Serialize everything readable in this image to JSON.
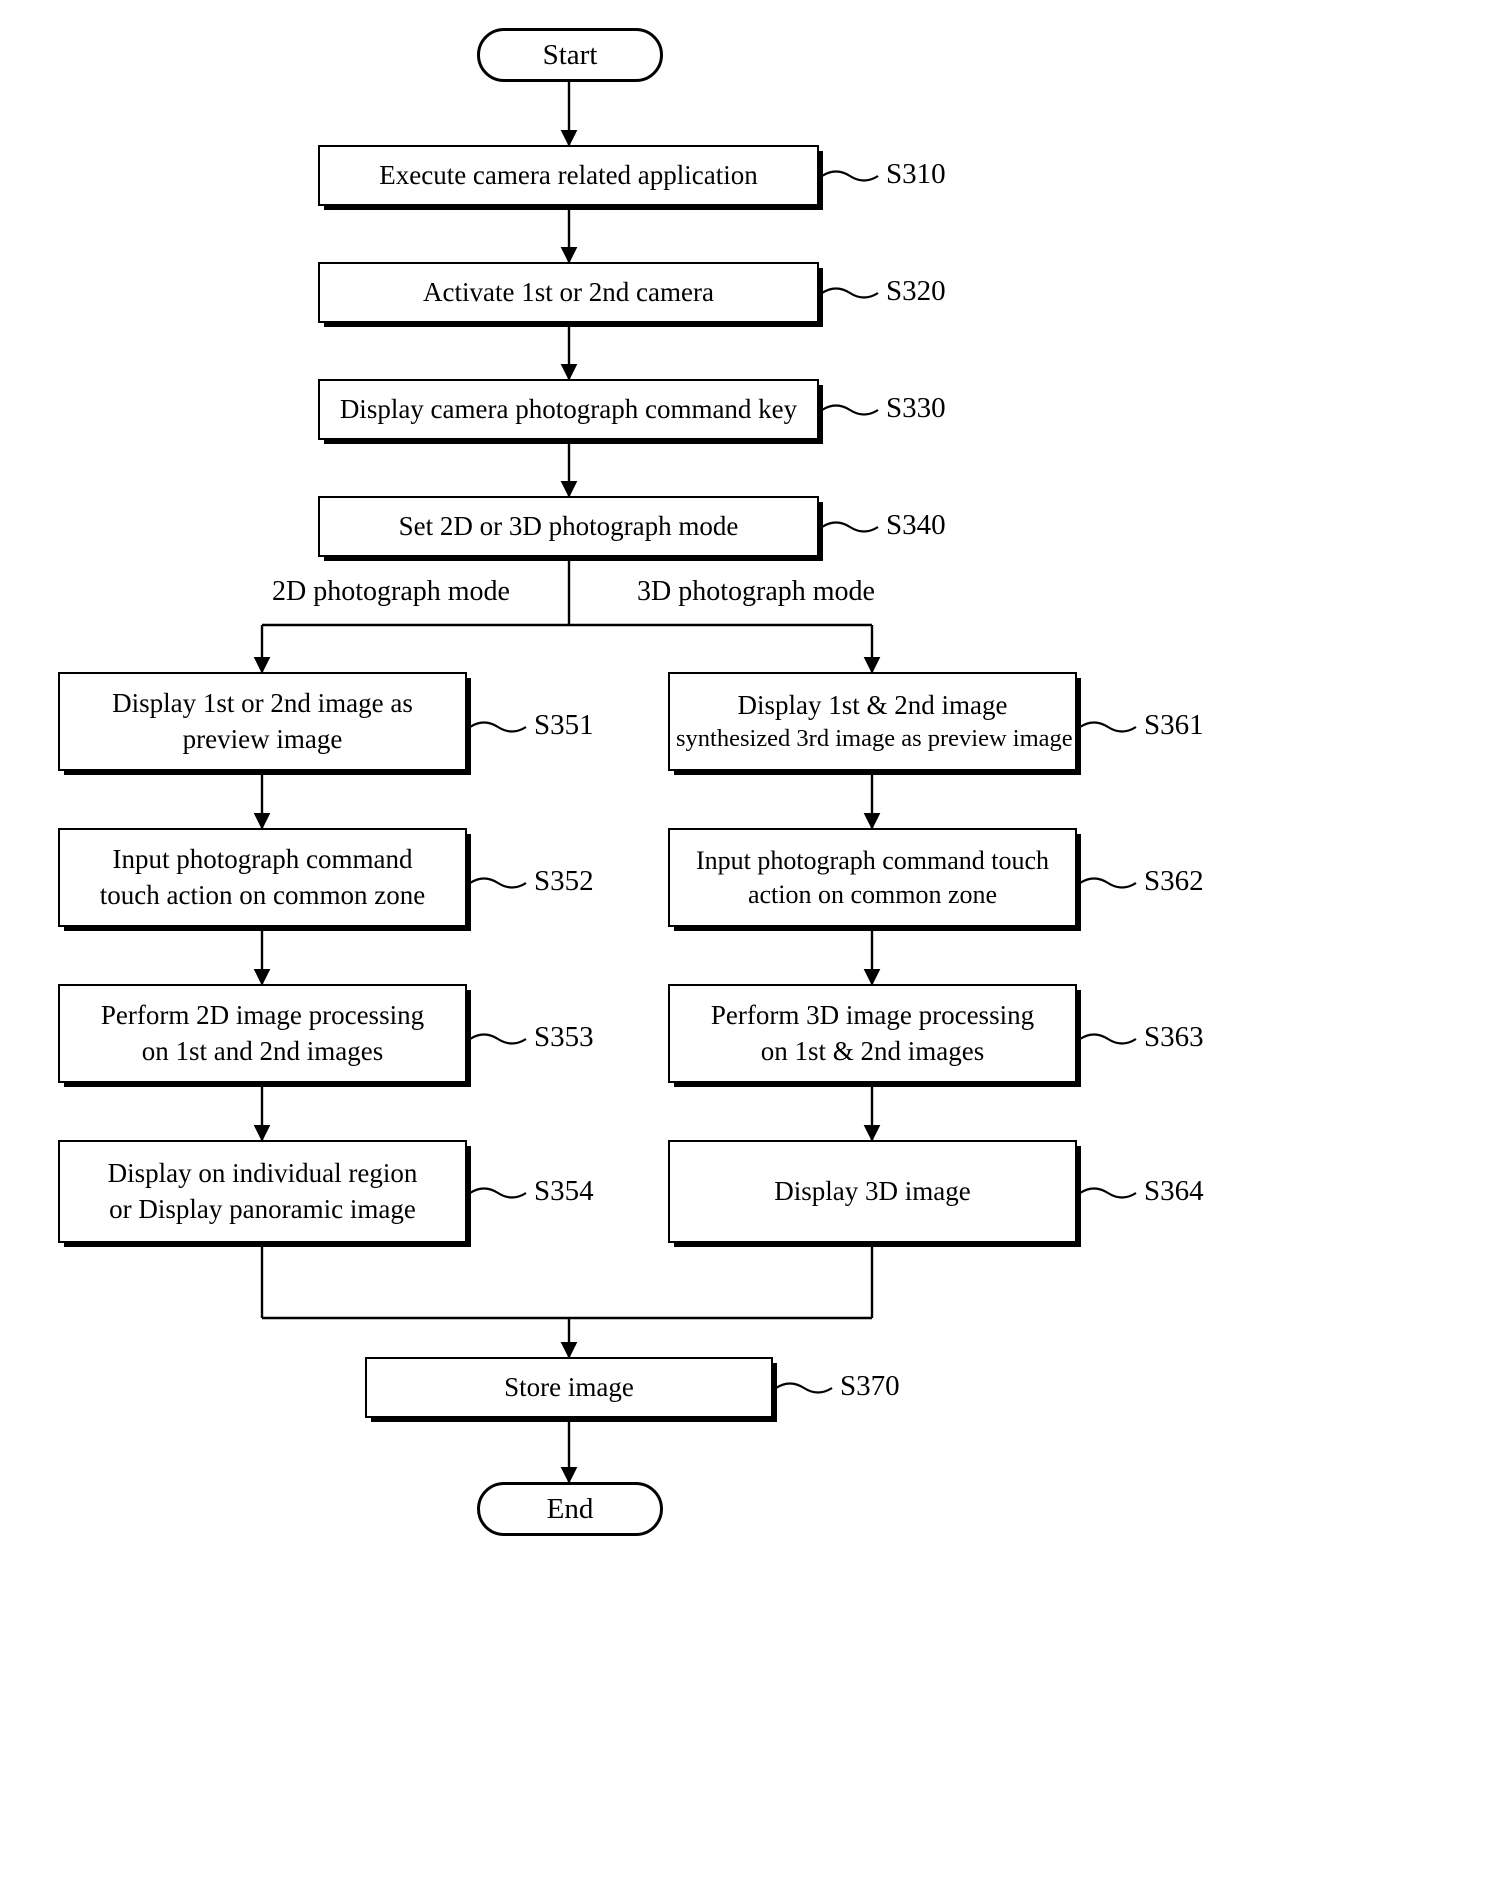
{
  "diagram": {
    "type": "flowchart",
    "title_text": "",
    "start": {
      "label": "Start"
    },
    "end": {
      "label": "End"
    },
    "main_steps": [
      {
        "id": "S310",
        "text_lines": [
          "Execute camera related application"
        ],
        "ref": "S310"
      },
      {
        "id": "S320",
        "text_lines": [
          "Activate 1st or 2nd camera"
        ],
        "ref": "S320"
      },
      {
        "id": "S330",
        "text_lines": [
          "Display camera photograph command key"
        ],
        "ref": "S330"
      },
      {
        "id": "S340",
        "text_lines": [
          "Set 2D or 3D photograph mode"
        ],
        "ref": "S340"
      }
    ],
    "branch_labels": {
      "left": "2D photograph mode",
      "right": "3D photograph mode"
    },
    "left_branch": [
      {
        "id": "S351",
        "text_lines": [
          "Display 1st or 2nd image as",
          "preview image"
        ],
        "ref": "S351"
      },
      {
        "id": "S352",
        "text_lines": [
          "Input photograph command",
          "touch action on common zone"
        ],
        "ref": "S352"
      },
      {
        "id": "S353",
        "text_lines": [
          "Perform 2D image processing",
          "on 1st and 2nd images"
        ],
        "ref": "S353"
      },
      {
        "id": "S354",
        "text_lines": [
          "Display on individual region",
          "or Display panoramic image"
        ],
        "ref": "S354"
      }
    ],
    "right_branch": [
      {
        "id": "S361",
        "text_lines": [
          "Display 1st & 2nd image",
          "synthesized 3rd image as preview image"
        ],
        "ref": "S361"
      },
      {
        "id": "S362",
        "text_lines": [
          "Input photograph command touch",
          "action on common zone"
        ],
        "ref": "S362"
      },
      {
        "id": "S363",
        "text_lines": [
          "Perform 3D image processing",
          "on 1st & 2nd images"
        ],
        "ref": "S363"
      },
      {
        "id": "S364",
        "text_lines": [
          "Display 3D image"
        ],
        "ref": "S364"
      }
    ],
    "merge_step": {
      "id": "S370",
      "text_lines": [
        "Store image"
      ],
      "ref": "S370"
    },
    "colors": {
      "line": "#000000",
      "box_fill": "#ffffff",
      "background": "#ffffff"
    }
  }
}
